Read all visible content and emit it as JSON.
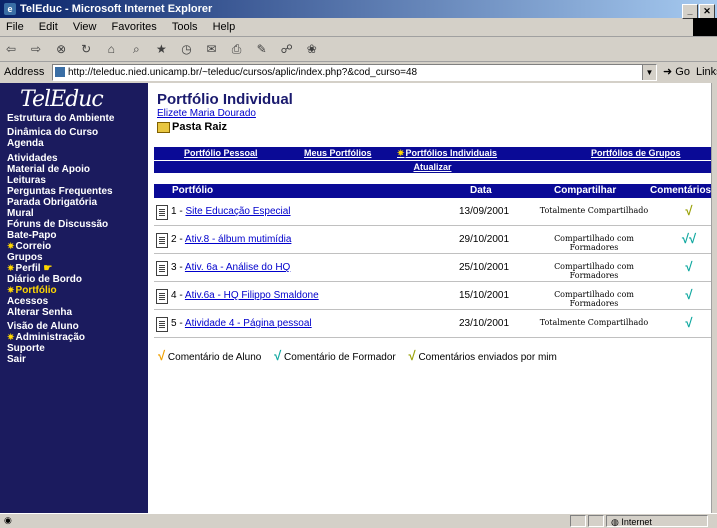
{
  "window": {
    "title": "TelEduc - Microsoft Internet Explorer",
    "min": "_",
    "close": "✕"
  },
  "menu": [
    "File",
    "Edit",
    "View",
    "Favorites",
    "Tools",
    "Help"
  ],
  "address": {
    "label": "Address",
    "url": "http://teleduc.nied.unicamp.br/~teleduc/cursos/aplic/index.php?&cod_curso=48",
    "go": "Go",
    "links": "Links"
  },
  "logo": "TelEduc",
  "sidebar": {
    "g1": [
      "Estrutura do Ambiente"
    ],
    "g2": [
      "Dinâmica do Curso",
      "Agenda"
    ],
    "g3": [
      "Atividades",
      "Material de Apoio",
      "Leituras",
      "Perguntas Frequentes",
      "Parada Obrigatória"
    ],
    "g4": [
      "Mural",
      "Fóruns de Discussão",
      "Bate-Papo",
      "Correio"
    ],
    "g5": [
      "Grupos",
      "Perfil",
      "Diário de Bordo",
      "Portfólio"
    ],
    "g6": [
      "Acessos",
      "Alterar Senha"
    ],
    "g7": [
      "Visão de Aluno",
      "Administração",
      "Suporte",
      "Sair"
    ]
  },
  "page": {
    "title": "Portfólio Individual",
    "owner": "Elizete Maria Dourado",
    "folder": "Pasta Raiz",
    "tabs": [
      "Portfólio Pessoal",
      "Meus Portfólios",
      "Portfólios Individuais",
      "Portfólios de Grupos"
    ],
    "refresh": "Atualizar",
    "columns": [
      "Portfólio",
      "Data",
      "Compartilhar",
      "Comentários"
    ],
    "rows": [
      {
        "num": "1 - ",
        "name": "Site Educação Especial",
        "date": "13/09/2001",
        "share": "Totalmente Compartilhado",
        "comments": "√"
      },
      {
        "num": "2 - ",
        "name": "Ativ.8 - álbum mutimídia",
        "date": "29/10/2001",
        "share": "Compartilhado com Formadores",
        "comments": "√√"
      },
      {
        "num": "3 - ",
        "name": "Ativ. 6a - Análise do HQ",
        "date": "25/10/2001",
        "share": "Compartilhado com Formadores",
        "comments": "√"
      },
      {
        "num": "4 - ",
        "name": "Ativ.6a - HQ Filippo Smaldone",
        "date": "15/10/2001",
        "share": "Compartilhado com Formadores",
        "comments": "√"
      },
      {
        "num": "5 - ",
        "name": "Atividade 4 - Página pessoal",
        "date": "23/10/2001",
        "share": "Totalmente Compartilhado",
        "comments": "√"
      }
    ],
    "legend": [
      "Comentário de Aluno",
      "Comentário de Formador",
      "Comentários enviados por mim"
    ]
  },
  "status": {
    "zone": "Internet"
  },
  "colors": {
    "sidebar": "#1b1b5e",
    "bar": "#0a0a96",
    "highlight": "#ffd700"
  }
}
